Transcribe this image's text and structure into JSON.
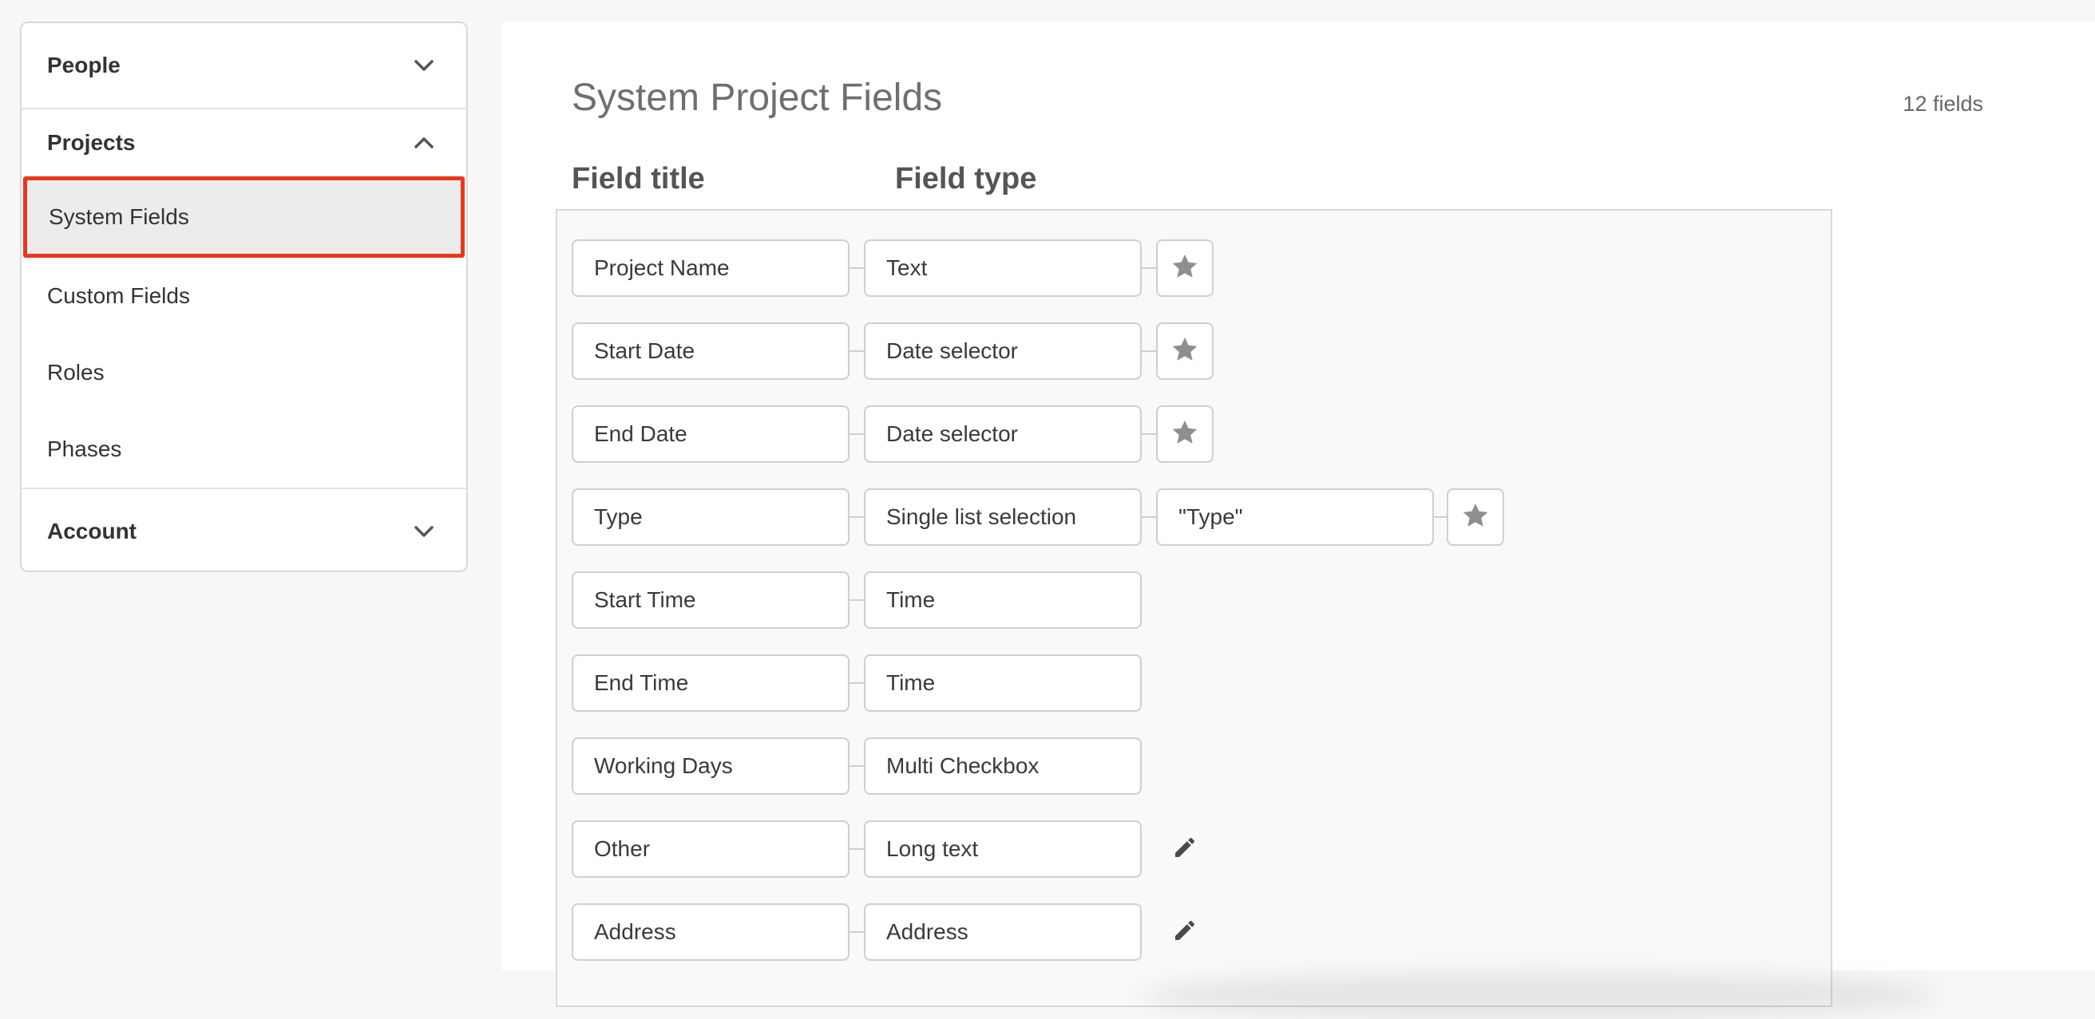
{
  "sidebar": {
    "sections": [
      {
        "label": "People",
        "expanded": false
      },
      {
        "label": "Projects",
        "expanded": true
      },
      {
        "label": "Account",
        "expanded": false
      }
    ],
    "items": [
      {
        "label": "System Fields",
        "selected": true
      },
      {
        "label": "Custom Fields",
        "selected": false
      },
      {
        "label": "Roles",
        "selected": false
      },
      {
        "label": "Phases",
        "selected": false
      }
    ]
  },
  "main": {
    "title": "System Project Fields",
    "count_label": "12 fields",
    "columns": {
      "title": "Field title",
      "type": "Field type"
    },
    "rows": [
      {
        "title": "Project Name",
        "type": "Text",
        "extra": null,
        "action": "star"
      },
      {
        "title": "Start Date",
        "type": "Date selector",
        "extra": null,
        "action": "star"
      },
      {
        "title": "End Date",
        "type": "Date selector",
        "extra": null,
        "action": "star"
      },
      {
        "title": "Type",
        "type": "Single list selection",
        "extra": "\"Type\"",
        "action": "star"
      },
      {
        "title": "Start Time",
        "type": "Time",
        "extra": null,
        "action": null
      },
      {
        "title": "End Time",
        "type": "Time",
        "extra": null,
        "action": null
      },
      {
        "title": "Working Days",
        "type": "Multi Checkbox",
        "extra": null,
        "action": null
      },
      {
        "title": "Other",
        "type": "Long text",
        "extra": null,
        "action": "edit"
      },
      {
        "title": "Address",
        "type": "Address",
        "extra": null,
        "action": "edit"
      }
    ]
  },
  "colors": {
    "selected_border": "#e8381c",
    "selected_bg": "#ececec",
    "icon_gray": "#8f8f8f"
  },
  "icons": {
    "chevron_down": "chevron-down-icon",
    "chevron_up": "chevron-up-icon",
    "star": "star-icon",
    "edit": "pencil-icon"
  }
}
